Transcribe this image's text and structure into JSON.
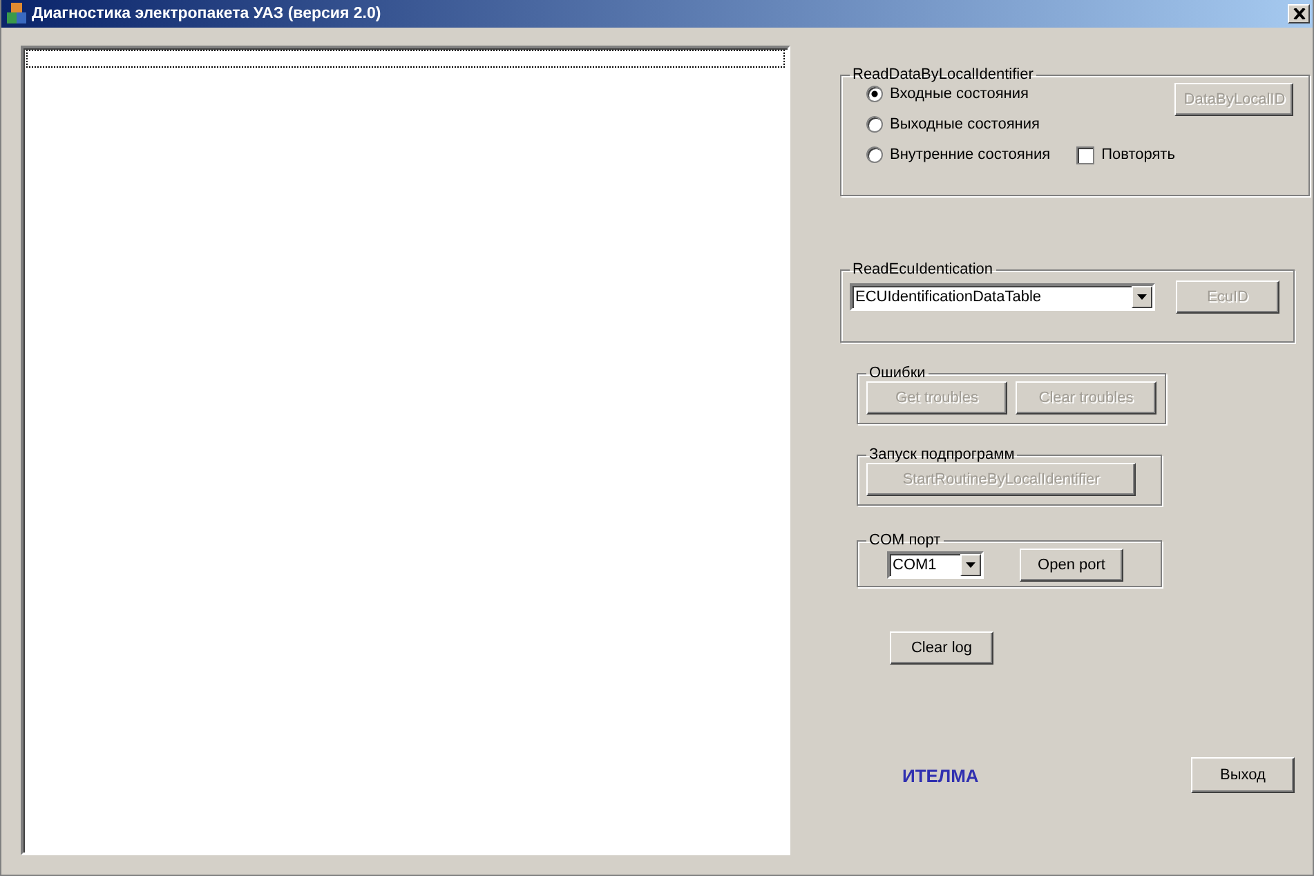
{
  "window": {
    "title": "Диагностика электропакета УАЗ (версия 2.0)"
  },
  "read_data": {
    "title": "ReadDataByLocalIdentifier",
    "radios": [
      {
        "label": "Входные состояния",
        "selected": true
      },
      {
        "label": "Выходные состояния",
        "selected": false
      },
      {
        "label": "Внутренние состояния",
        "selected": false
      }
    ],
    "repeat": {
      "label": "Повторять",
      "checked": false
    },
    "button": {
      "label": "DataByLocalID",
      "disabled": true
    }
  },
  "read_ecu": {
    "title": "ReadEcuIdentication",
    "dropdown": {
      "value": "ECUIdentificationDataTable"
    },
    "button": {
      "label": "EcuID",
      "disabled": true
    }
  },
  "errors": {
    "title": "Ошибки",
    "buttons": [
      {
        "label": "Get troubles",
        "disabled": true
      },
      {
        "label": "Clear troubles",
        "disabled": true
      }
    ]
  },
  "routines": {
    "title": "Запуск подпрограмм",
    "button": {
      "label": "StartRoutineByLocalIdentifier",
      "disabled": true
    }
  },
  "com_port": {
    "title": "COM порт",
    "dropdown": {
      "value": "COM1"
    },
    "button": {
      "label": "Open port",
      "disabled": false
    }
  },
  "clear_log": {
    "label": "Clear log",
    "disabled": false
  },
  "brand": "ИТЕЛМА",
  "exit": {
    "label": "Выход",
    "disabled": false
  }
}
